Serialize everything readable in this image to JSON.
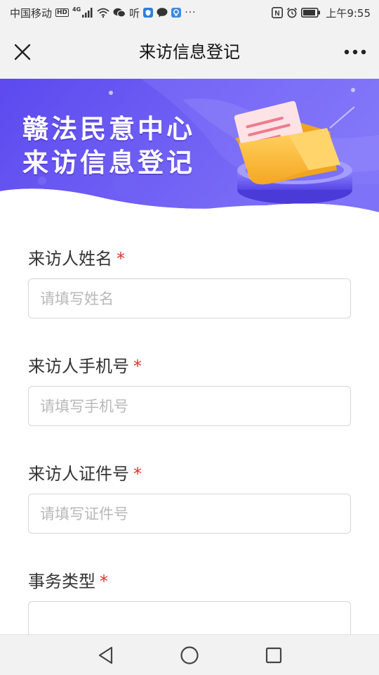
{
  "status_bar": {
    "carrier": "中国移动",
    "hd": "HD",
    "network": "4G",
    "listen": "听",
    "more": "···",
    "nfc": "N",
    "time": "上午9:55"
  },
  "nav": {
    "title": "来访信息登记"
  },
  "banner": {
    "line1": "赣法民意中心",
    "line2": "来访信息登记"
  },
  "form": {
    "required_mark": "*",
    "fields": [
      {
        "label": "来访人姓名",
        "placeholder": "请填写姓名",
        "value": ""
      },
      {
        "label": "来访人手机号",
        "placeholder": "请填写手机号",
        "value": ""
      },
      {
        "label": "来访人证件号",
        "placeholder": "请填写证件号",
        "value": ""
      },
      {
        "label": "事务类型",
        "placeholder": "",
        "value": ""
      }
    ]
  },
  "colors": {
    "banner_start": "#5f4cf0",
    "banner_end": "#7b6df7",
    "required": "#e0332f"
  }
}
